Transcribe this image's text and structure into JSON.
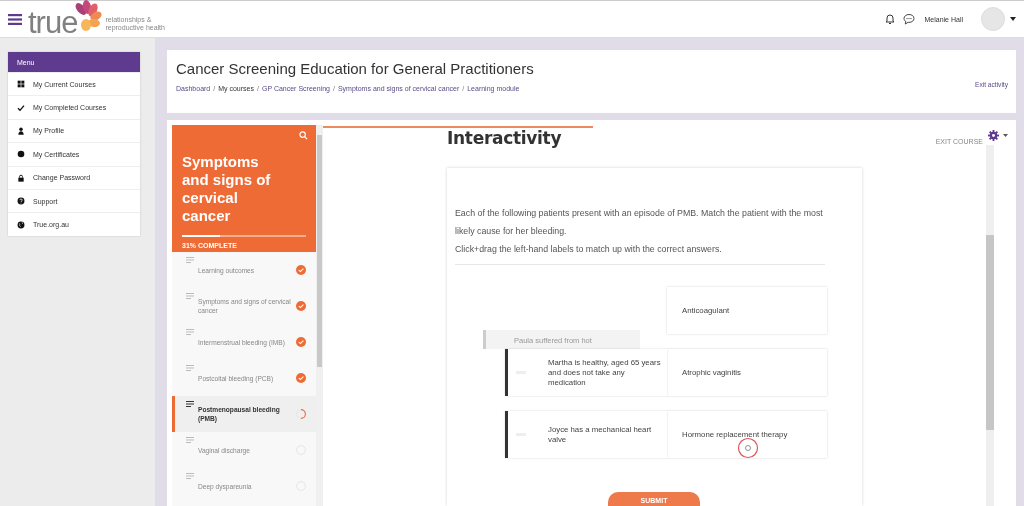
{
  "header": {
    "logo": {
      "wordmark": "true",
      "tagline": "relationships & reproductive health"
    },
    "user_name": "Melanie Hall"
  },
  "menu": {
    "title": "Menu",
    "items": [
      {
        "label": "My Current Courses"
      },
      {
        "label": "My Completed Courses"
      },
      {
        "label": "My Profile"
      },
      {
        "label": "My Certificates"
      },
      {
        "label": "Change Password"
      },
      {
        "label": "Support"
      },
      {
        "label": "True.org.au"
      }
    ]
  },
  "course": {
    "title": "Cancer Screening Education for General Practitioners",
    "breadcrumb_separator": "/",
    "breadcrumb": [
      {
        "label": "Dashboard",
        "link": true
      },
      {
        "label": "My courses",
        "link": false
      },
      {
        "label": "GP Cancer Screening",
        "link": true
      },
      {
        "label": "Symptoms and signs of cervical cancer",
        "link": true
      },
      {
        "label": "Learning module",
        "link": true
      }
    ],
    "exit_link": "Exit activity"
  },
  "module_nav": {
    "title": "Symptoms and signs of cervical cancer",
    "progress": {
      "label": "31% COMPLETE",
      "level": 0.31
    },
    "items": [
      {
        "label": "Learning outcomes",
        "completed": true,
        "selected": false
      },
      {
        "label": "Symptoms and signs of cervical cancer",
        "completed": true,
        "selected": false
      },
      {
        "label": "Intermenstrual bleeding (IMB)",
        "completed": true,
        "selected": false
      },
      {
        "label": "Postcoital bleeding (PCB)",
        "completed": true,
        "selected": false
      },
      {
        "label": "Postmenopausal bleeding (PMB)",
        "completed": false,
        "started": true,
        "selected": true
      },
      {
        "label": "Vaginal discharge",
        "completed": false,
        "started": false,
        "selected": false
      },
      {
        "label": "Deep dyspareunia",
        "completed": false,
        "started": false,
        "selected": false
      }
    ]
  },
  "activity": {
    "heading": "Interactivity",
    "exit_course": "EXIT COURSE",
    "instructions": [
      "Each of the following patients present with an episode of PMB. Match the patient with the most likely cause for her bleeding.",
      "Click+drag the left-hand labels to match up with the correct answers."
    ],
    "dragged_item": "Paula suffered from hot",
    "rows": [
      {
        "answer": "Anticoagulant"
      },
      {
        "patient": "Martha is healthy, aged 65 years and does not take any medication",
        "answer": "Atrophic vaginitis"
      },
      {
        "patient": "Joyce has a mechanical heart valve",
        "answer": "Hormone replacement therapy"
      }
    ],
    "submit_button": "SUBMIT"
  }
}
